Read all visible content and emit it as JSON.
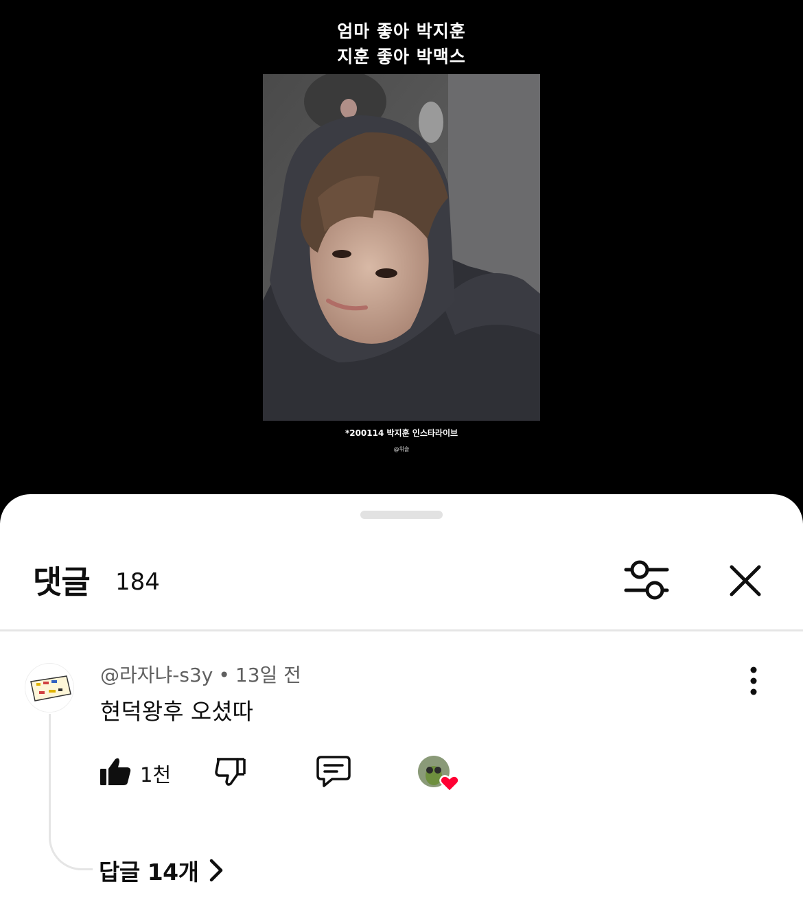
{
  "video": {
    "caption_line1": "엄마 좋아 박지훈",
    "caption_line2": "지훈 좋아 박맥스",
    "caption_bottom": "*200114 박지훈 인스타라이브",
    "caption_credit": "@위슬"
  },
  "comments_panel": {
    "title": "댓글",
    "count": "184",
    "icons": {
      "filter": "sliders-icon",
      "close": "close-icon"
    }
  },
  "comment": {
    "author": "@라자냐-s3y",
    "separator": "•",
    "time": "13일 전",
    "text": "현덕왕후 오셨따",
    "like_count": "1천",
    "replies_label": "답글 14개",
    "icons": {
      "like": "thumbs-up-icon",
      "dislike": "thumbs-down-icon",
      "reply": "comment-icon",
      "more": "more-vertical-icon",
      "creator_heart": "heart-icon",
      "chevron": "chevron-right-icon"
    },
    "heart_color": "#ff0033"
  }
}
